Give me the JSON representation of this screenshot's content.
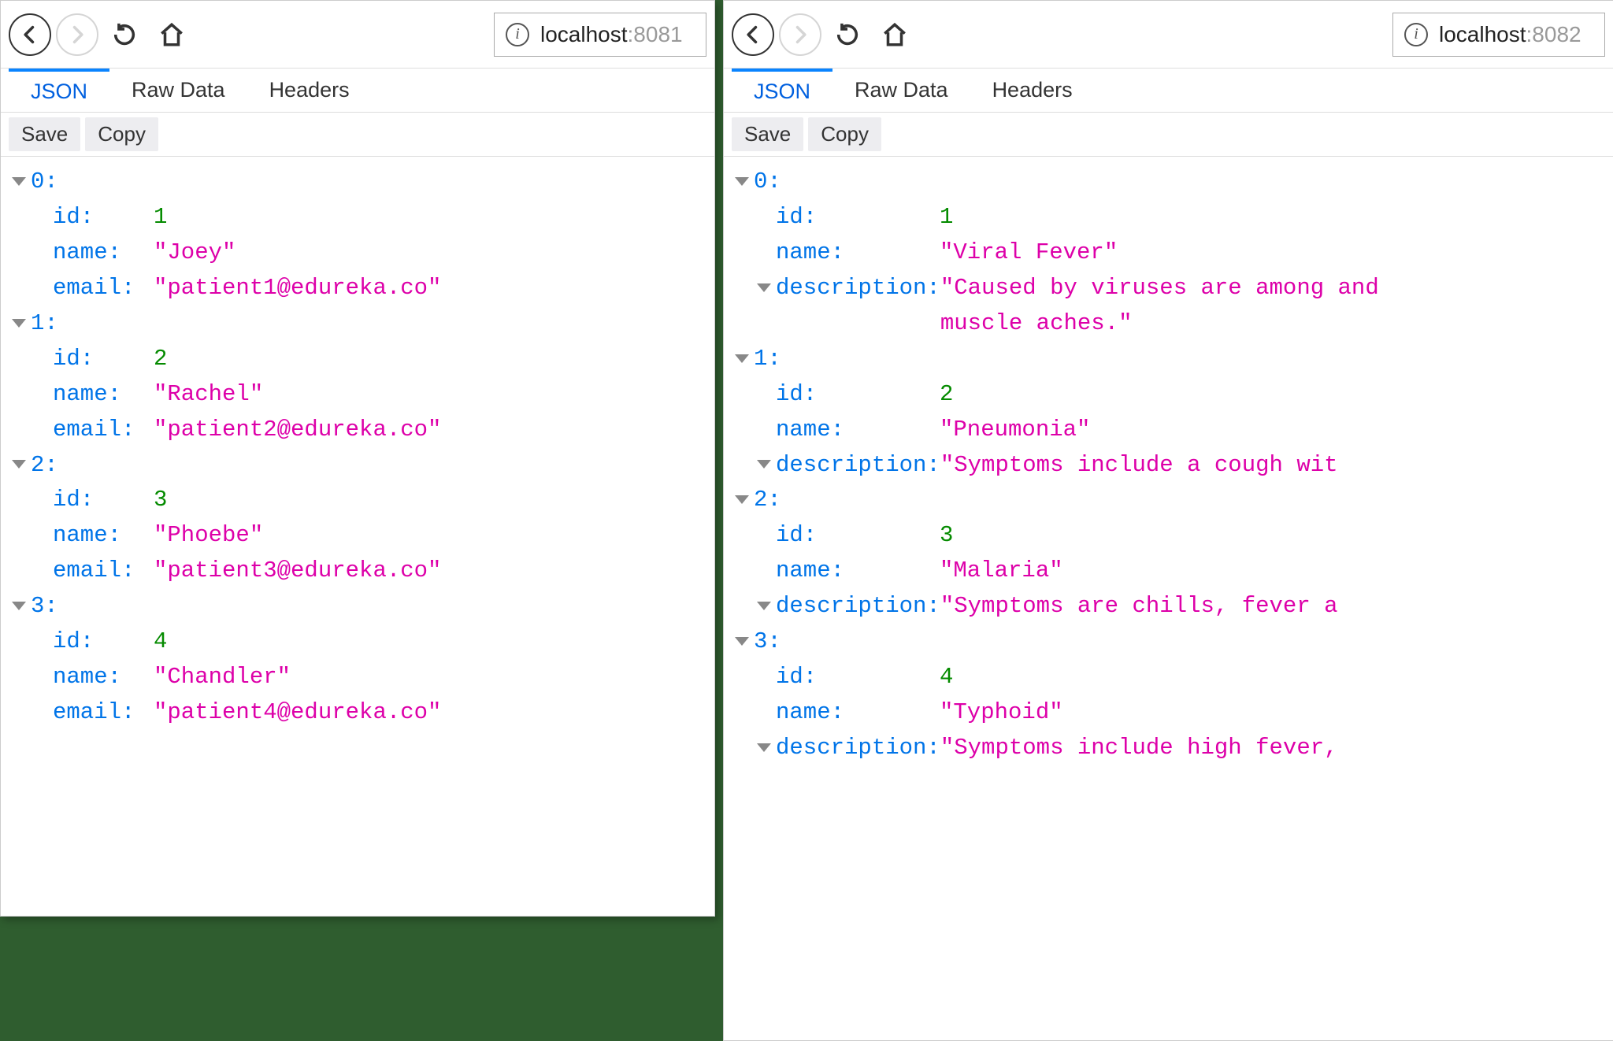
{
  "panes": [
    {
      "url_host": "localhost",
      "url_port": ":8081",
      "tabs": {
        "json": "JSON",
        "raw": "Raw Data",
        "headers": "Headers"
      },
      "actions": {
        "save": "Save",
        "copy": "Copy"
      },
      "records": [
        {
          "idx": "0:",
          "id_lbl": "id:",
          "id": "1",
          "name_lbl": "name:",
          "name": "\"Joey\"",
          "f3_lbl": "email:",
          "f3": "\"patient1@edureka.co\"",
          "f3_arrow": false
        },
        {
          "idx": "1:",
          "id_lbl": "id:",
          "id": "2",
          "name_lbl": "name:",
          "name": "\"Rachel\"",
          "f3_lbl": "email:",
          "f3": "\"patient2@edureka.co\"",
          "f3_arrow": false
        },
        {
          "idx": "2:",
          "id_lbl": "id:",
          "id": "3",
          "name_lbl": "name:",
          "name": "\"Phoebe\"",
          "f3_lbl": "email:",
          "f3": "\"patient3@edureka.co\"",
          "f3_arrow": false
        },
        {
          "idx": "3:",
          "id_lbl": "id:",
          "id": "4",
          "name_lbl": "name:",
          "name": "\"Chandler\"",
          "f3_lbl": "email:",
          "f3": "\"patient4@edureka.co\"",
          "f3_arrow": false
        }
      ]
    },
    {
      "url_host": "localhost",
      "url_port": ":8082",
      "tabs": {
        "json": "JSON",
        "raw": "Raw Data",
        "headers": "Headers"
      },
      "actions": {
        "save": "Save",
        "copy": "Copy"
      },
      "records": [
        {
          "idx": "0:",
          "id_lbl": "id:",
          "id": "1",
          "name_lbl": "name:",
          "name": "\"Viral Fever\"",
          "f3_lbl": "description:",
          "f3": "\"Caused by viruses are among and muscle aches.\"",
          "f3_arrow": true,
          "f3_multiline": true
        },
        {
          "idx": "1:",
          "id_lbl": "id:",
          "id": "2",
          "name_lbl": "name:",
          "name": "\"Pneumonia\"",
          "f3_lbl": "description:",
          "f3": "\"Symptoms include a cough wit",
          "f3_arrow": true
        },
        {
          "idx": "2:",
          "id_lbl": "id:",
          "id": "3",
          "name_lbl": "name:",
          "name": "\"Malaria\"",
          "f3_lbl": "description:",
          "f3": "\"Symptoms are chills, fever a",
          "f3_arrow": true
        },
        {
          "idx": "3:",
          "id_lbl": "id:",
          "id": "4",
          "name_lbl": "name:",
          "name": "\"Typhoid\"",
          "f3_lbl": "description:",
          "f3": "\"Symptoms include high fever,",
          "f3_arrow": true
        }
      ]
    }
  ],
  "info_icon_glyph": "i"
}
